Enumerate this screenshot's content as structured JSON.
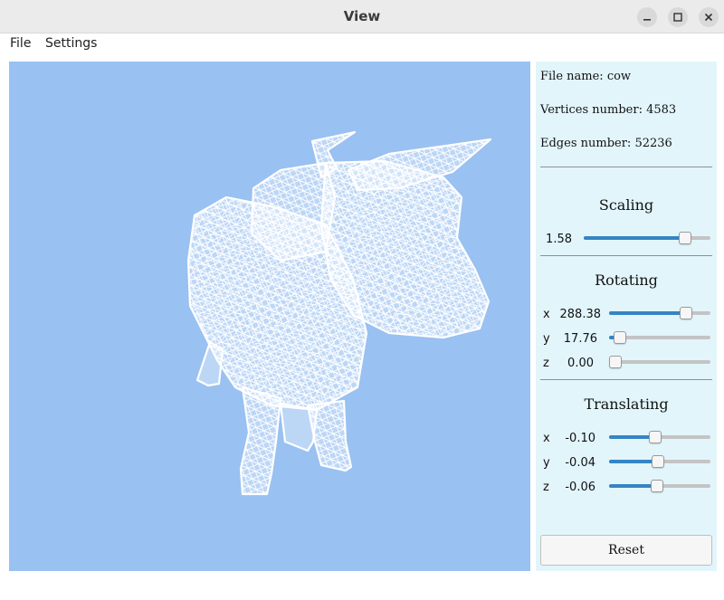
{
  "window": {
    "title": "View"
  },
  "menu": {
    "file": "File",
    "settings": "Settings"
  },
  "info": {
    "file_name": "File  name:  cow",
    "vertices": "Vertices  number:  4583",
    "edges": "Edges  number:  52236"
  },
  "scaling": {
    "title": "Scaling",
    "value": "1.58",
    "level": 0.83
  },
  "rotating": {
    "title": "Rotating",
    "x": {
      "label": "x",
      "value": "288.38",
      "level": 0.8
    },
    "y": {
      "label": "y",
      "value": "17.76",
      "level": 0.05
    },
    "z": {
      "label": "z",
      "value": "0.00",
      "level": 0.0
    }
  },
  "translating": {
    "title": "Translating",
    "x": {
      "label": "x",
      "value": "-0.10",
      "level": 0.45
    },
    "y": {
      "label": "y",
      "value": "-0.04",
      "level": 0.48
    },
    "z": {
      "label": "z",
      "value": "-0.06",
      "level": 0.47
    }
  },
  "reset_label": "Reset",
  "colors": {
    "viewport_bg": "#99c1f1",
    "panel_bg": "#e2f5fb",
    "slider_fill": "#3584c4",
    "wireframe": "#ffffff"
  },
  "icons": [
    "minimize-icon",
    "maximize-icon",
    "close-icon"
  ]
}
